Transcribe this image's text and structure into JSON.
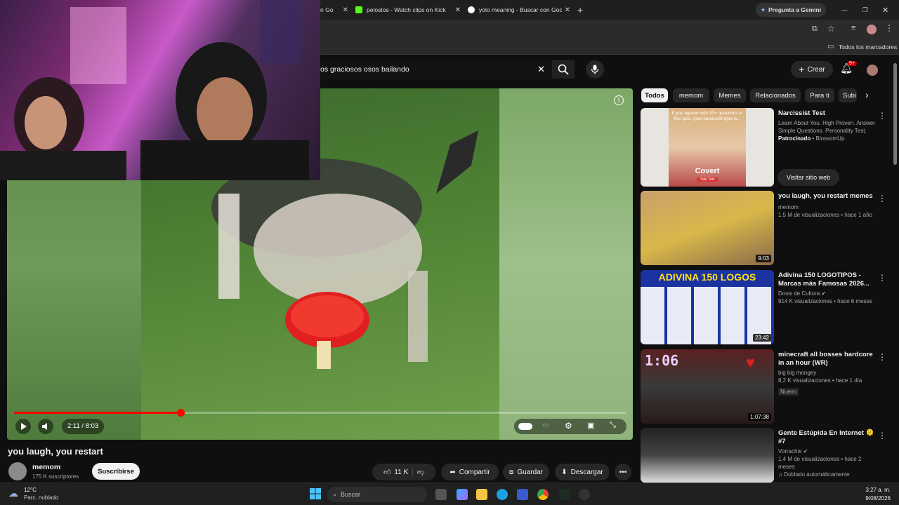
{
  "browser": {
    "tabs": [
      {
        "label": "n Go"
      },
      {
        "label": "pelosIos - Watch clips on Kick"
      },
      {
        "label": "yolo meaning - Buscar con Goo"
      }
    ],
    "new_tab": "+",
    "gemini_button": "Pregunta a Gemini",
    "bookmarks_label": "Todos los marcadores"
  },
  "youtube": {
    "search": {
      "value": "os graciosos osos bailando"
    },
    "create_label": "Crear",
    "notifications_badge": "9+",
    "video": {
      "title": "you laugh, you restart",
      "time": "2:11 / 8:03",
      "progress": 0.272
    },
    "channel": {
      "name": "memom",
      "subscribers": "175 K suscriptores",
      "subscribe_label": "Suscribirse"
    },
    "actions": {
      "likes": "11 K",
      "share": "Compartir",
      "save": "Guardar",
      "download": "Descargar"
    },
    "chips": [
      "Todos",
      "memom",
      "Memes",
      "Relacionados",
      "Para ti",
      "Subi"
    ],
    "ad": {
      "title": "Narcissist Test",
      "description": "Learn About You. High Proven. Answer Simple Questions. Personality Test.",
      "sponsored": "Patrocinado",
      "advertiser": "BlossomUp",
      "cta": "Visitar sitio web",
      "thumb_caption": "If you agreed with 30+ questions in this quiz, your narcissist type is...",
      "thumb_big": "Covert",
      "thumb_small": "Take Test"
    },
    "recommendations": [
      {
        "title": "you laugh, you restart memes",
        "channel": "memom",
        "meta": "1,5 M de visualizaciones • hace 1 año",
        "duration": "9:03"
      },
      {
        "title": "Adivina 150 LOGOTIPOS - Marcas más Famosas 2026...",
        "channel": "Dosis de Cultura",
        "meta": "914 K visualizaciones • hace 6 meses",
        "duration": "23:42",
        "thumb_text": "ADIVINA 150 LOGOS"
      },
      {
        "title": "minecraft all bosses hardcore in an hour (WR)",
        "channel": "big big mongey",
        "meta": "8,2 K visualizaciones • hace 1 día",
        "badge": "Nuevo",
        "duration": "1:07:38",
        "thumb_text": "1:06"
      },
      {
        "title": "Gente Estúpida En Internet 🫠 #7",
        "channel": "Vorrachis",
        "meta": "1,4 M de visualizaciones • hace 2 meses",
        "badge": "Doblado automáticamente"
      }
    ]
  },
  "taskbar": {
    "weather_temp": "12°C",
    "weather_desc": "Parc. nublado",
    "search_placeholder": "Buscar",
    "time": "3:27 a. m.",
    "date": "9/08/2026"
  },
  "colors": {
    "accent_red": "#ff0000",
    "background": "#0f0f0f",
    "chip_bg": "#272727"
  }
}
